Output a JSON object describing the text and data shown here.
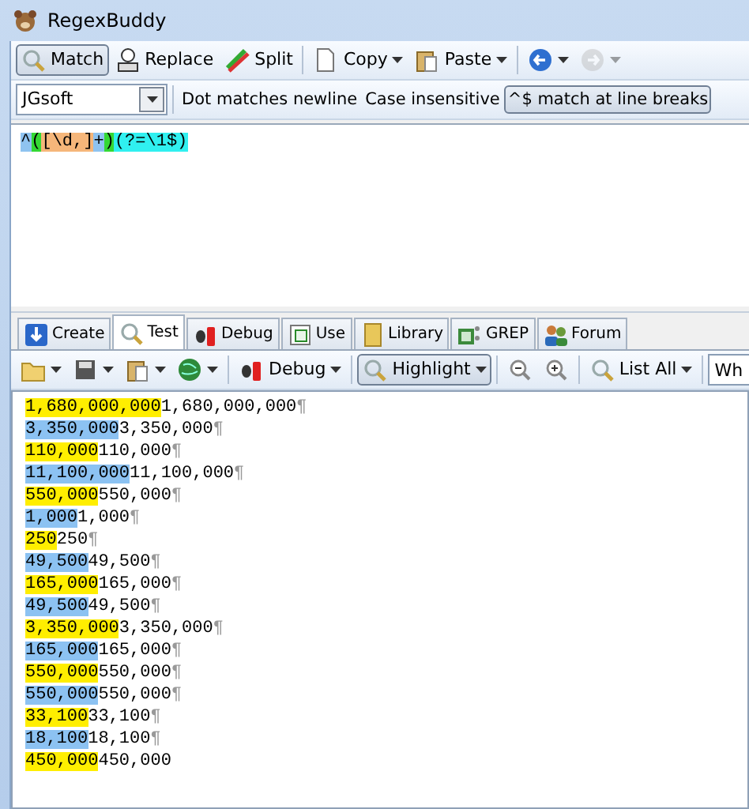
{
  "window": {
    "title": "RegexBuddy"
  },
  "toolbar": [
    {
      "label": "Match",
      "selected": true,
      "dropdown": false,
      "disabled": false
    },
    {
      "label": "Replace",
      "selected": false,
      "dropdown": false,
      "disabled": false
    },
    {
      "label": "Split",
      "selected": false,
      "dropdown": false,
      "disabled": false
    },
    {
      "label": "Copy",
      "selected": false,
      "dropdown": true,
      "disabled": false
    },
    {
      "label": "Paste",
      "selected": false,
      "dropdown": true,
      "disabled": false
    },
    {
      "selected": false,
      "dropdown": true,
      "disabled": false
    },
    {
      "selected": false,
      "dropdown": true,
      "disabled": true
    }
  ],
  "flavor": {
    "value": "JGsoft"
  },
  "options": [
    {
      "label": "Dot matches newline",
      "selected": false
    },
    {
      "label": "Case insensitive",
      "selected": false
    },
    {
      "label": "^$ match at line breaks",
      "selected": true
    }
  ],
  "regex": [
    {
      "text": "^",
      "color": "#8fc3f0"
    },
    {
      "text": "(",
      "color": "#34d834"
    },
    {
      "text": "[\\d,]",
      "color": "#f5b67a"
    },
    {
      "text": "+",
      "color": "#8fc3f0"
    },
    {
      "text": ")",
      "color": "#34d834"
    },
    {
      "text": "(?=\\1$)",
      "color": "#30f0f0"
    }
  ],
  "tabs": [
    {
      "label": "Create",
      "selected": false
    },
    {
      "label": "Test",
      "selected": true
    },
    {
      "label": "Debug",
      "selected": false
    },
    {
      "label": "Use",
      "selected": false
    },
    {
      "label": "Library",
      "selected": false
    },
    {
      "label": "GREP",
      "selected": false
    },
    {
      "label": "Forum",
      "selected": false
    }
  ],
  "test_toolbar": [
    {
      "selected": false,
      "dropdown": true
    },
    {
      "selected": false,
      "dropdown": true
    },
    {
      "selected": false,
      "dropdown": true
    },
    {
      "selected": false,
      "dropdown": true
    },
    {
      "label": "Debug",
      "selected": false,
      "dropdown": true
    },
    {
      "label": "Highlight",
      "selected": true,
      "dropdown": true
    },
    {
      "selected": false,
      "dropdown": false
    },
    {
      "selected": false,
      "dropdown": false
    },
    {
      "label": "List All",
      "selected": false,
      "dropdown": true
    }
  ],
  "test_field": {
    "value": "Wh"
  },
  "test_lines": [
    {
      "match": "1,680,000,000",
      "rest": "1,680,000,000",
      "end": "¶",
      "color": "#ffee00"
    },
    {
      "match": "3,350,000",
      "rest": "3,350,000",
      "end": "¶",
      "color": "#8cc2f2"
    },
    {
      "match": "110,000",
      "rest": "110,000",
      "end": "¶",
      "color": "#ffee00"
    },
    {
      "match": "11,100,000",
      "rest": "11,100,000",
      "end": "¶",
      "color": "#8cc2f2"
    },
    {
      "match": "550,000",
      "rest": "550,000",
      "end": "¶",
      "color": "#ffee00"
    },
    {
      "match": "1,000",
      "rest": "1,000",
      "end": "¶",
      "color": "#8cc2f2"
    },
    {
      "match": "250",
      "rest": "250",
      "end": "¶",
      "color": "#ffee00"
    },
    {
      "match": "49,500",
      "rest": "49,500",
      "end": "¶",
      "color": "#8cc2f2"
    },
    {
      "match": "165,000",
      "rest": "165,000",
      "end": "¶",
      "color": "#ffee00"
    },
    {
      "match": "49,500",
      "rest": "49,500",
      "end": "¶",
      "color": "#8cc2f2"
    },
    {
      "match": "3,350,000",
      "rest": "3,350,000",
      "end": "¶",
      "color": "#ffee00"
    },
    {
      "match": "165,000",
      "rest": "165,000",
      "end": "¶",
      "color": "#8cc2f2"
    },
    {
      "match": "550,000",
      "rest": "550,000",
      "end": "¶",
      "color": "#ffee00"
    },
    {
      "match": "550,000",
      "rest": "550,000",
      "end": "¶",
      "color": "#8cc2f2"
    },
    {
      "match": "33,100",
      "rest": "33,100",
      "end": "¶",
      "color": "#ffee00"
    },
    {
      "match": "18,100",
      "rest": "18,100",
      "end": "¶",
      "color": "#8cc2f2"
    },
    {
      "match": "450,000",
      "rest": "450,000",
      "color": "#ffee00"
    }
  ]
}
